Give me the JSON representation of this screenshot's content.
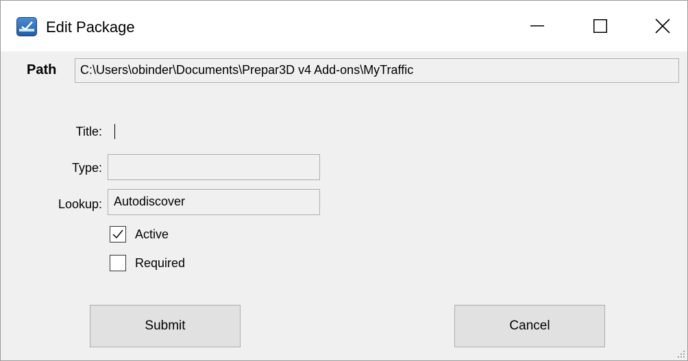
{
  "window": {
    "title": "Edit Package",
    "icon": "app-window-icon",
    "controls": [
      "minimize-icon",
      "maximize-icon",
      "close-icon"
    ]
  },
  "path": {
    "label": "Path",
    "value": "C:\\Users\\obinder\\Documents\\Prepar3D v4 Add-ons\\MyTraffic"
  },
  "form": {
    "title_label": "Title:",
    "title_value": "",
    "type_label": "Type:",
    "type_value": "",
    "lookup_label": "Lookup:",
    "lookup_value": "Autodiscover"
  },
  "checkboxes": {
    "active": {
      "label": "Active",
      "checked": true
    },
    "required": {
      "label": "Required",
      "checked": false
    }
  },
  "buttons": {
    "submit_label": "Submit",
    "cancel_label": "Cancel"
  },
  "colors": {
    "focus_border": "#0078d7",
    "window_bg": "#f0f0f0",
    "button_bg": "#e1e1e1"
  }
}
